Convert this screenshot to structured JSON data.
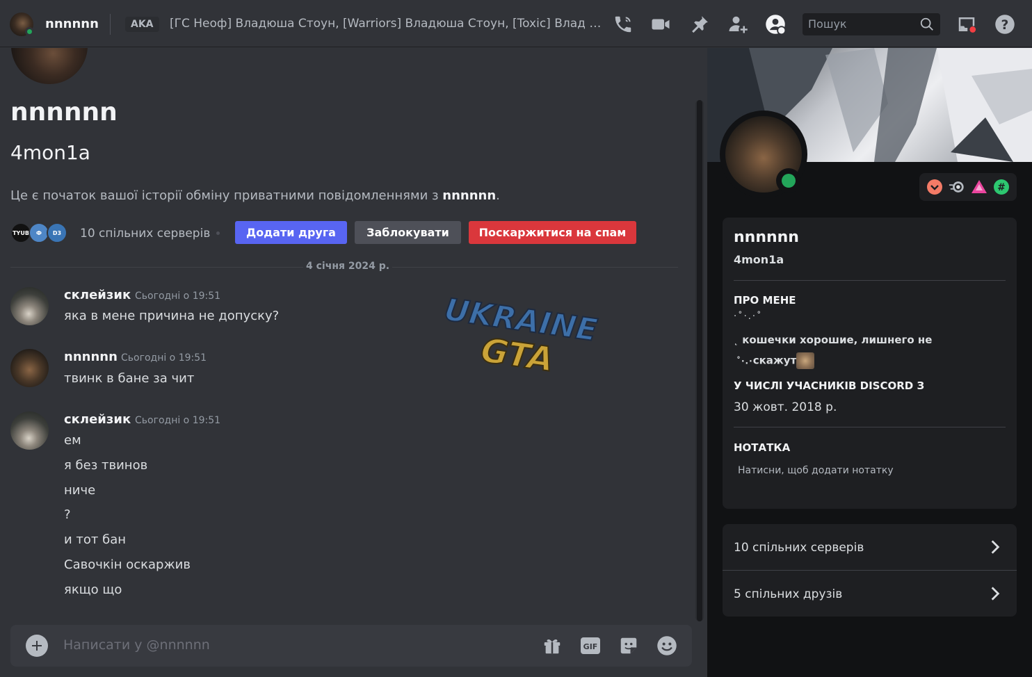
{
  "header": {
    "username": "nnnnnn",
    "aka_label": "AKA",
    "aka_list": "[ГС Неоф] Владюша Стоун, [Warriors] Владюша Стоун, [Toxic] Влад Зінченко",
    "search_placeholder": "Пошук",
    "icons": [
      "phone-call-icon",
      "video-call-icon",
      "pin-icon",
      "add-friend-icon",
      "profile-toggle-icon",
      "search-icon",
      "inbox-icon",
      "help-icon"
    ]
  },
  "intro": {
    "display_name": "nnnnnn",
    "username": "4mon1a",
    "description_prefix": "Це є початок вашої історії обміну приватними повідомленнями з ",
    "description_name": "nnnnnn",
    "description_suffix": ".",
    "mutual_servers": "10 спільних серверів",
    "server_icons": [
      "TYUB",
      "Ф",
      "D3"
    ],
    "buttons": {
      "add_friend": "Додати друга",
      "block": "Заблокувати",
      "report_spam": "Поскаржитися на спам"
    }
  },
  "date_divider": "4 січня 2024 р.",
  "messages": [
    {
      "author": "склейзик",
      "timestamp": "Сьогодні о 19:51",
      "lines": [
        "яка в мене причина не допуску?"
      ]
    },
    {
      "author": "nnnnnn",
      "timestamp": "Сьогодні о 19:51",
      "lines": [
        "твинк в бане за чит"
      ]
    },
    {
      "author": "склейзик",
      "timestamp": "Сьогодні о 19:51",
      "lines": [
        "ем",
        "я без твинов",
        "ниче",
        "?",
        "и тот бан",
        "Савочкін оскаржив",
        "якщо що"
      ]
    }
  ],
  "watermark": {
    "line1": "UKRAINE",
    "line2": "GTA"
  },
  "composer": {
    "placeholder": "Написати у @nnnnnn",
    "gif_label": "GIF"
  },
  "profile": {
    "display_name": "nnnnnn",
    "username": "4mon1a",
    "about_heading": "ПРО МЕНЕ",
    "about_sparkles_top": "·˚·.·˚",
    "about_line1": "кошечки хорошие, лишнего не",
    "about_line2": "скажут",
    "member_since_heading": "У ЧИСЛІ УЧАСНИКІВ DISCORD З",
    "member_since": "30 жовт. 2018 р.",
    "note_heading": "НОТАТКА",
    "note_placeholder": "Натисни, щоб додати нотатку",
    "mutual_servers": "10 спільних серверів",
    "mutual_friends": "5 спільних друзів",
    "badge_colors": [
      "#f47b67",
      "#b5bac1",
      "#eb459e",
      "#2dc770"
    ],
    "status_color": "#23a55a"
  }
}
